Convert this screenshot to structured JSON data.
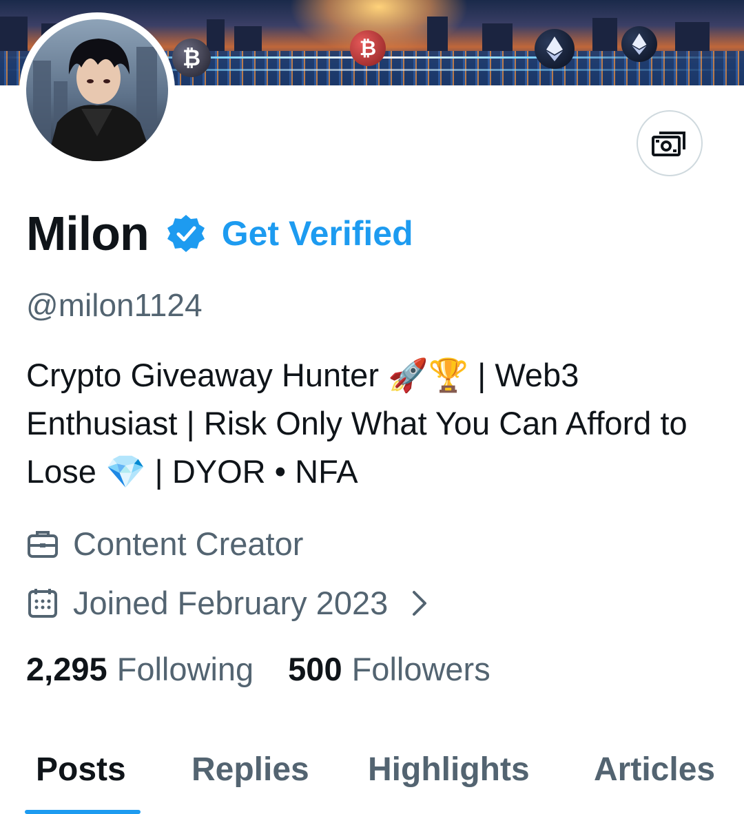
{
  "profile": {
    "name": "Milon",
    "verify_label": "Get Verified",
    "handle": "@milon1124",
    "bio": "Crypto Giveaway Hunter 🚀🏆 | Web3 Enthusiast | Risk Only What You Can Afford to Lose 💎 | DYOR • NFA",
    "profession": "Content Creator",
    "joined": "Joined February 2023"
  },
  "stats": {
    "following_count": "2,295",
    "following_label": "Following",
    "followers_count": "500",
    "followers_label": "Followers"
  },
  "tabs": [
    {
      "label": "Posts",
      "active": true
    },
    {
      "label": "Replies",
      "active": false
    },
    {
      "label": "Highlights",
      "active": false
    },
    {
      "label": "Articles",
      "active": false
    }
  ],
  "banner": {
    "coins": [
      "bitcoin-icon",
      "bitcoin-icon",
      "ethereum-icon",
      "ethereum-icon"
    ],
    "coin_symbol_btc": "₿"
  },
  "icons": {
    "verified": "verified-badge-icon",
    "tip": "money-tip-icon",
    "profession": "briefcase-icon",
    "joined": "calendar-icon",
    "expand": "chevron-right-icon"
  },
  "colors": {
    "accent": "#1d9bf0",
    "text_primary": "#0f1419",
    "text_secondary": "#536471",
    "border": "#cfd9de"
  }
}
